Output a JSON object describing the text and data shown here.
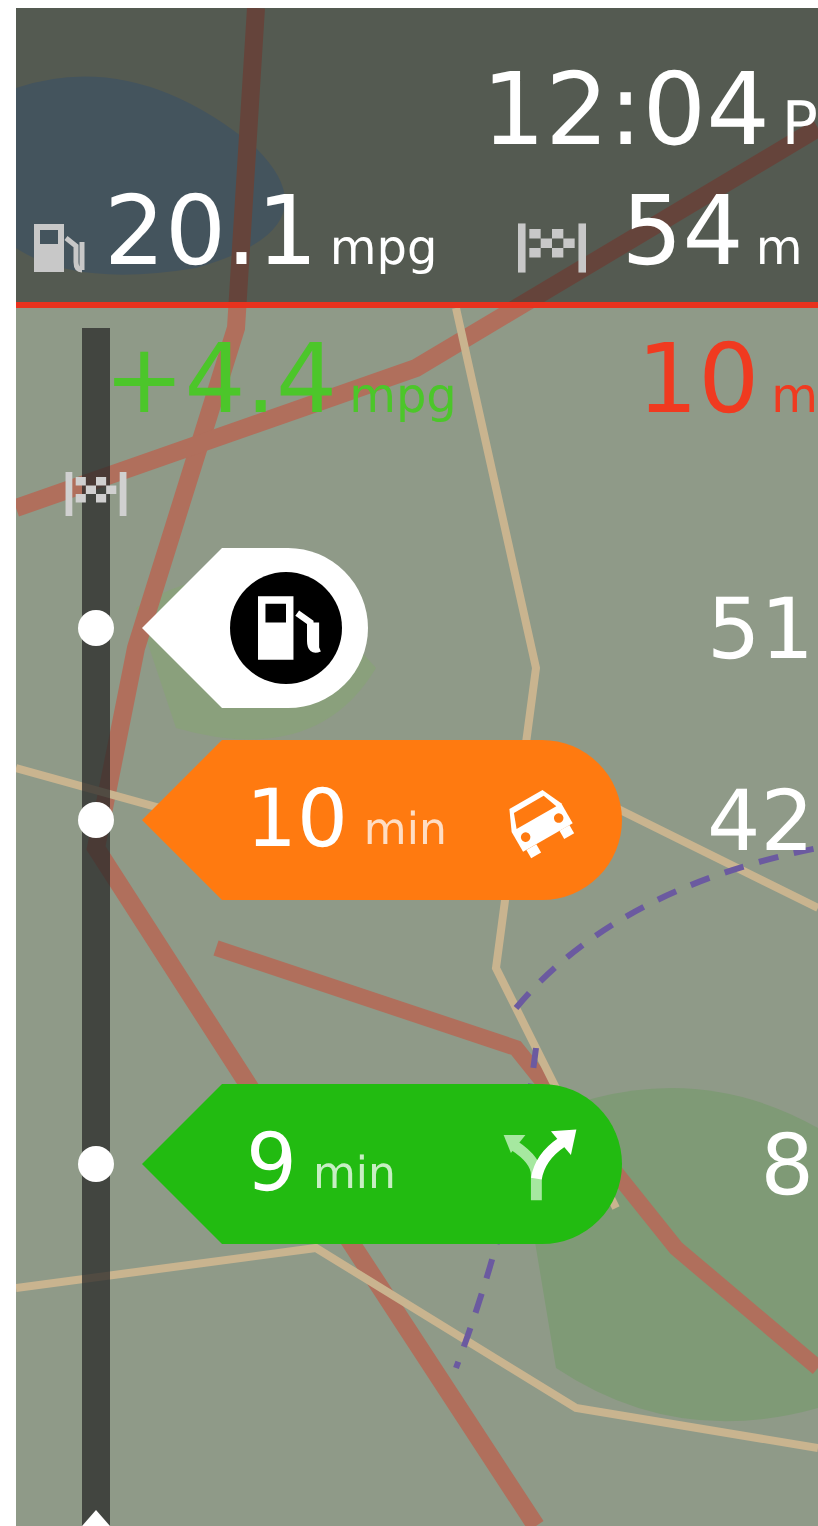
{
  "header": {
    "time": "12:04",
    "time_suffix": "P",
    "fuel": {
      "value": "20.1",
      "unit": "mpg"
    },
    "distance": {
      "value": "54",
      "unit": "m"
    }
  },
  "deltas": {
    "fuel": {
      "value": "+4.4",
      "unit": "mpg"
    },
    "time": {
      "value": "10",
      "unit": "m"
    }
  },
  "route_bar": {
    "events": [
      {
        "kind": "fuel-stop",
        "distance": "51"
      },
      {
        "kind": "traffic",
        "value": "10",
        "unit": "min",
        "distance": "42"
      },
      {
        "kind": "turn",
        "value": "9",
        "unit": "min",
        "distance": "8"
      }
    ]
  }
}
